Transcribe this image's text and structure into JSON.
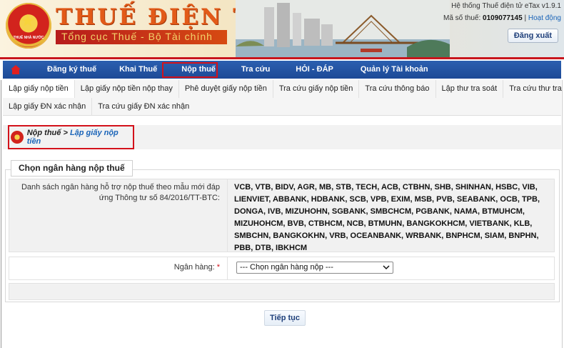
{
  "header": {
    "brand_title": "THUẾ ĐIỆN TỬ",
    "brand_subtitle": "Tổng cục Thuế - Bộ Tài chính",
    "emblem_text": "THUẾ NHÀ NƯỚC",
    "system_title": "Hệ thống Thuế điện tử eTax v1.9.1",
    "tax_id_label": "Mã số thuế:",
    "tax_id_value": "0109077145",
    "status_text": "Hoạt động",
    "logout_label": "Đăng xuất"
  },
  "main_nav": {
    "items": [
      {
        "label": "Đăng ký thuế"
      },
      {
        "label": "Khai Thuế"
      },
      {
        "label": "Nộp thuế"
      },
      {
        "label": "Tra cứu"
      },
      {
        "label": "HỎI - ĐÁP"
      },
      {
        "label": "Quản lý Tài khoản"
      }
    ],
    "active_index": 2
  },
  "sub_nav": {
    "row1": [
      {
        "label": "Lập giấy nộp tiền"
      },
      {
        "label": "Lập giấy nộp tiền nộp thay"
      },
      {
        "label": "Phê duyệt giấy nộp tiền"
      },
      {
        "label": "Tra cứu giấy nộp tiền"
      },
      {
        "label": "Tra cứu thông báo"
      },
      {
        "label": "Lập thư tra soát"
      },
      {
        "label": "Tra cứu thư tra soát"
      }
    ],
    "row2": [
      {
        "label": "Lập giấy ĐN xác nhận"
      },
      {
        "label": "Tra cứu giấy ĐN xác nhận"
      }
    ]
  },
  "breadcrumb": {
    "parent": "Nộp thuế",
    "separator": " > ",
    "current": "Lập giấy nộp tiền"
  },
  "form": {
    "section_title": "Chọn ngân hàng nộp thuế",
    "bank_list_label": "Danh sách ngân hàng hỗ trợ nộp thuế theo mẫu mới đáp ứng Thông tư số 84/2016/TT-BTC:",
    "bank_list": "VCB, VTB, BIDV, AGR, MB, STB, TECH, ACB, CTBHN, SHB, SHINHAN, HSBC, VIB, LIENVIET, ABBANK, HDBANK, SCB, VPB, EXIM, MSB, PVB, SEABANK, OCB, TPB, DONGA, IVB, MIZUHOHN, SGBANK, SMBCHCM, PGBANK, NAMA, BTMUHCM, MIZUHOHCM, BVB, CTBHCM, NCB, BTMUHN, BANGKOKHCM, VIETBANK, KLB, SMBCHN, BANGKOKHN, VRB, OCEANBANK, WRBANK, BNPHCM, SIAM, BNPHN, PBB, DTB, IBKHCM",
    "bank_select_label": "Ngân hàng:",
    "required_mark": "*",
    "bank_select_value": "--- Chọn ngân hàng nộp ---",
    "submit_label": "Tiếp tục"
  },
  "colors": {
    "nav_blue": "#1d4a97",
    "accent_red": "#d3121b",
    "brand_orange": "#e25a18",
    "link_blue": "#1a64b8"
  }
}
